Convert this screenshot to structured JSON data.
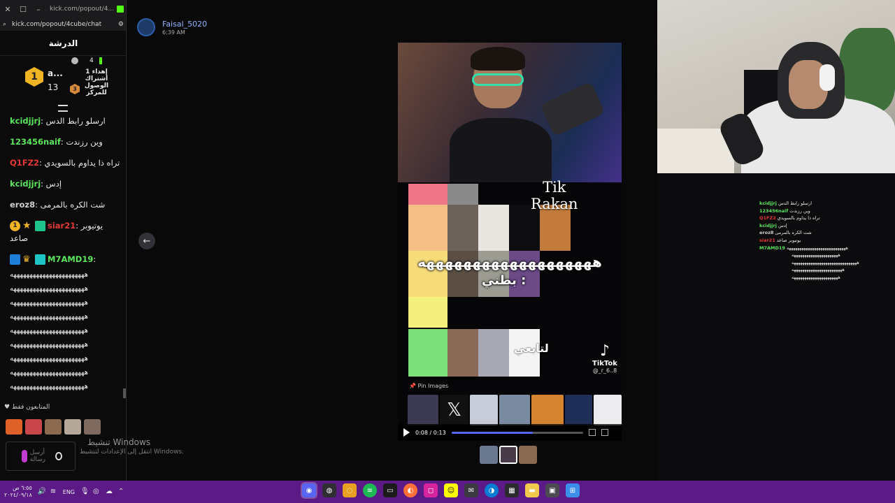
{
  "chat_window": {
    "url_title": "kick.com/popout/4...",
    "url": "kick.com/popout/4cube/chat",
    "header": "الدرشة",
    "pinned": {
      "user_short": "a...",
      "level": "1",
      "count": "13",
      "sub_level": "3",
      "gift_text": "إهداء 1 أشتراك الوصول للمركز",
      "top_count": "4"
    },
    "messages": [
      {
        "user": "kcidjjrj",
        "sep": ": ",
        "text": "ارسلو رابط الدس",
        "color": "#5ce65c"
      },
      {
        "user": "123456naif",
        "sep": ": ",
        "text": "وين رزندت",
        "color": "#5ce65c"
      },
      {
        "user": "Q1FZ2",
        "sep": ": ",
        "text": "تراه ذا يداوم بالسويدي",
        "color": "#e53935"
      },
      {
        "user": "kcidjjrj",
        "sep": ": ",
        "text": "إدس",
        "color": "#5ce65c"
      },
      {
        "user": "eroz8",
        "sep": ": ",
        "text": "شت الكره بالمرمى",
        "color": "#cfcfcf"
      },
      {
        "user": "siar21",
        "sep": ": ",
        "text": "يوتيوبر",
        "text2": "صاعد",
        "color": "#e53935"
      },
      {
        "user": "M7AMD19",
        "sep": ":",
        "text": "",
        "color": "#5ce65c"
      }
    ],
    "spam_lines": [
      "هههههههههههههههههههههههه",
      "هههههههههههههههههههههههه",
      "هههههههههههههههههههههههه",
      "هههههههههههههههههههههههه",
      "هههههههههههههههههههههههه",
      "هههههههههههههههههههههههه",
      "هههههههههههههههههههههههه",
      "هههههههههههههههههههههههه",
      "هههههههههههههههههههههههه"
    ],
    "followers_label": "المتابعون فقط",
    "input_placeholder": "أرسل رسالة"
  },
  "discord": {
    "uploader": "Faisal_5020",
    "time": "6:39 AM",
    "prev_arrow": "←",
    "next_arrow": "→"
  },
  "video": {
    "title_line1": "Tik",
    "title_line2": "Rakan",
    "overlay_text": "هههههههههههههههههههه",
    "overlay_text2": "بطني :",
    "follow_text": "لتابعي",
    "tiktok_name": "TikTok",
    "tiktok_handle": "@_r_6..8",
    "pin_label": "Pin Images",
    "time_display": "0:08 / 0:13",
    "progress": 0.62
  },
  "overlay_chat": [
    {
      "user": "kcidjjrj",
      "text": "ارسلو رابط الدس",
      "color": "#5ce65c"
    },
    {
      "user": "123456naif",
      "text": "وين رزندت",
      "color": "#5ce65c"
    },
    {
      "user": "Q1FZ2",
      "text": "تراه ذا يداوم بالسويدي",
      "color": "#e53935"
    },
    {
      "user": "kcidjjrj",
      "text": "إدس",
      "color": "#5ce65c"
    },
    {
      "user": "eroz8",
      "text": "شت الكره بالمرمى",
      "color": "#cfcfcf"
    },
    {
      "user": "siar21",
      "text": "يوتيوبر صاعد",
      "color": "#e53935"
    },
    {
      "user": "M7AMD19",
      "text": "ههههههههههههههههههههههههههههه",
      "color": "#5ce65c"
    }
  ],
  "overlay_spam": [
    "ههههههههههههههههههههههه",
    "هههههههههههههههههههههههههههههههه",
    "ههههههههههههههههههههههههه",
    "ههههههههههههههههههههههه"
  ],
  "windows_watermark": {
    "line1": "تنشيط Windows",
    "line2": "انتقل إلى الإعدادات لتنشيط Windows."
  },
  "taskbar": {
    "clock_time": "٦:٥٥ ص",
    "clock_date": "٢٠٢٤/٠٩/١٨",
    "language": "ENG"
  },
  "colors": {
    "taskbar": "#5b1a86",
    "kick_green": "#53fc18",
    "discord_blurple": "#5865f2"
  }
}
